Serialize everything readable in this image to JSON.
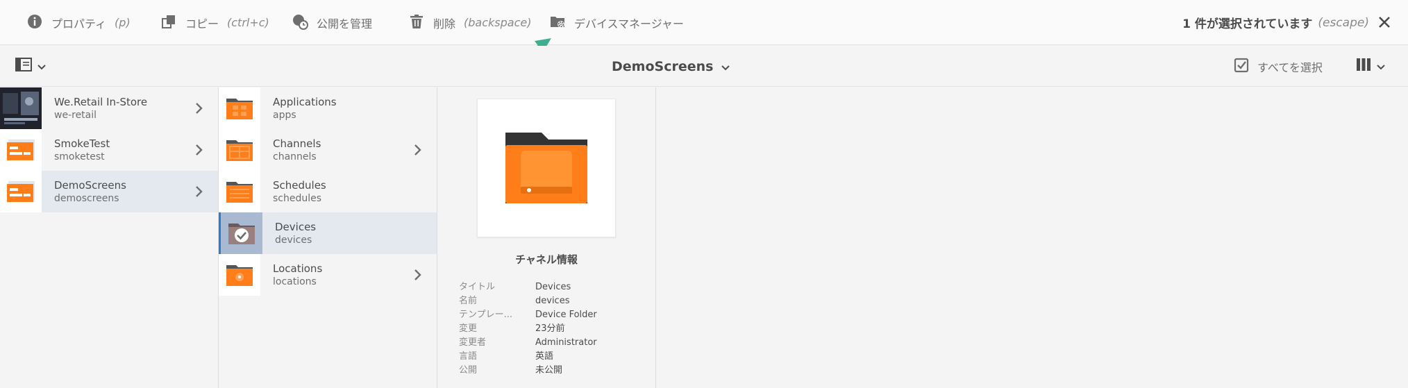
{
  "toolbar": {
    "actions": [
      {
        "label": "プロパティ",
        "shortcut": "(p)",
        "icon": "info-icon"
      },
      {
        "label": "コピー",
        "shortcut": "(ctrl+c)",
        "icon": "copy-icon"
      },
      {
        "label": "公開を管理",
        "shortcut": "",
        "icon": "globe-clock-icon"
      },
      {
        "label": "削除",
        "shortcut": "(backspace)",
        "icon": "trash-icon"
      },
      {
        "label": "デバイスマネージャー",
        "shortcut": "",
        "icon": "folder-gear-icon"
      }
    ],
    "selection_text": "1 件が選択されています",
    "selection_shortcut": "(escape)"
  },
  "subbar": {
    "breadcrumb": "DemoScreens",
    "select_all": "すべてを選択"
  },
  "column1": [
    {
      "title": "We.Retail In-Store",
      "name": "we-retail"
    },
    {
      "title": "SmokeTest",
      "name": "smoketest"
    },
    {
      "title": "DemoScreens",
      "name": "demoscreens"
    }
  ],
  "column2": [
    {
      "title": "Applications",
      "name": "apps"
    },
    {
      "title": "Channels",
      "name": "channels"
    },
    {
      "title": "Schedules",
      "name": "schedules"
    },
    {
      "title": "Devices",
      "name": "devices"
    },
    {
      "title": "Locations",
      "name": "locations"
    }
  ],
  "preview": {
    "title": "チャネル情報",
    "meta": [
      {
        "key": "タイトル",
        "value": "Devices"
      },
      {
        "key": "名前",
        "value": "devices"
      },
      {
        "key": "テンプレー...",
        "value": "Device Folder"
      },
      {
        "key": "変更",
        "value": "23分前"
      },
      {
        "key": "変更者",
        "value": "Administrator"
      },
      {
        "key": "言語",
        "value": "英語"
      },
      {
        "key": "公開",
        "value": "未公開"
      }
    ]
  },
  "colors": {
    "accent_orange": "#ff7e1a",
    "selection_blue": "#2d7bcc",
    "annotation_arrow": "#3fae90"
  }
}
